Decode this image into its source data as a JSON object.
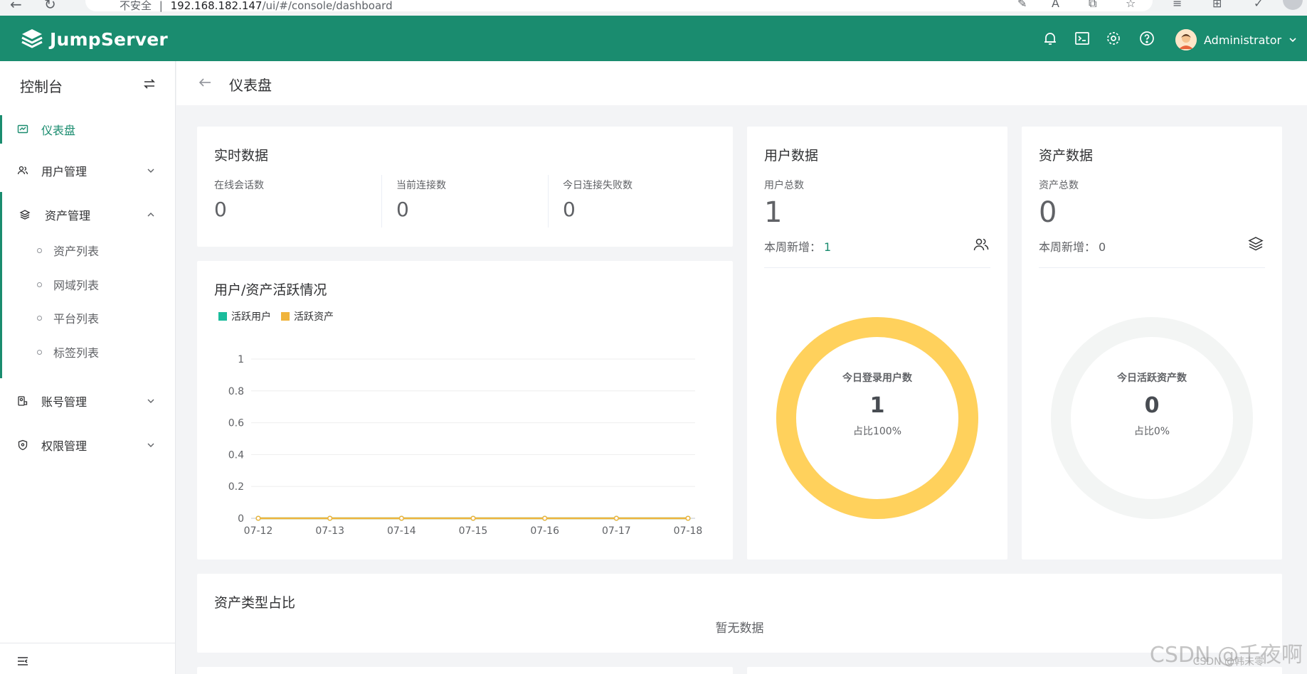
{
  "browser": {
    "back_glyph": "←",
    "reload_glyph": "↻",
    "security_label": "不安全",
    "separator": "|",
    "url_host": "192.168.182.147",
    "url_path": "/ui/#/console/dashboard"
  },
  "header": {
    "brand": "JumpServer",
    "user_name": "Administrator"
  },
  "sidebar": {
    "title": "控制台",
    "items": [
      {
        "label": "仪表盘"
      },
      {
        "label": "用户管理"
      },
      {
        "label": "资产管理"
      },
      {
        "label": "账号管理"
      },
      {
        "label": "权限管理"
      }
    ],
    "asset_sub_items": [
      {
        "label": "资产列表"
      },
      {
        "label": "网域列表"
      },
      {
        "label": "平台列表"
      },
      {
        "label": "标签列表"
      }
    ]
  },
  "breadcrumb": {
    "title": "仪表盘"
  },
  "realtime": {
    "title": "实时数据",
    "stats": [
      {
        "label": "在线会话数",
        "value": "0"
      },
      {
        "label": "当前连接数",
        "value": "0"
      },
      {
        "label": "今日连接失败数",
        "value": "0"
      }
    ]
  },
  "activity": {
    "title": "用户/资产活跃情况",
    "legend": [
      {
        "name": "活跃用户",
        "color": "#1abc9c"
      },
      {
        "name": "活跃资产",
        "color": "#f0b43c"
      }
    ]
  },
  "chart_data": {
    "type": "line",
    "x": [
      "07-12",
      "07-13",
      "07-14",
      "07-15",
      "07-16",
      "07-17",
      "07-18"
    ],
    "y_ticks": [
      "0",
      "0.2",
      "0.4",
      "0.6",
      "0.8",
      "1"
    ],
    "ylim": [
      0,
      1
    ],
    "grid": true,
    "legend_position": "top-left",
    "series": [
      {
        "name": "活跃用户",
        "color": "#1abc9c",
        "values": [
          0,
          0,
          0,
          0,
          0,
          0,
          0
        ]
      },
      {
        "name": "活跃资产",
        "color": "#f0b43c",
        "values": [
          0,
          0,
          0,
          0,
          0,
          0,
          0
        ]
      }
    ]
  },
  "users": {
    "title": "用户数据",
    "total_label": "用户总数",
    "total": "1",
    "week_label": "本周新增：",
    "week_value": "1",
    "ring_label": "今日登录用户数",
    "ring_value": "1",
    "ring_pct": "占比100%",
    "ring_fraction": 1.0,
    "ring_color": "#ffd15c"
  },
  "assets": {
    "title": "资产数据",
    "total_label": "资产总数",
    "total": "0",
    "week_label": "本周新增：",
    "week_value": "0",
    "ring_label": "今日活跃资产数",
    "ring_value": "0",
    "ring_pct": "占比0%",
    "ring_fraction": 0.0,
    "ring_color": "#f3f5f4"
  },
  "asset_types": {
    "title": "资产类型占比",
    "empty": "暂无数据"
  },
  "watermark": {
    "main": "CSDN @千夜啊",
    "small": "CSDN @韩未零"
  },
  "colors": {
    "brand": "#1a8c6f",
    "accent": "#1a8c6f"
  }
}
